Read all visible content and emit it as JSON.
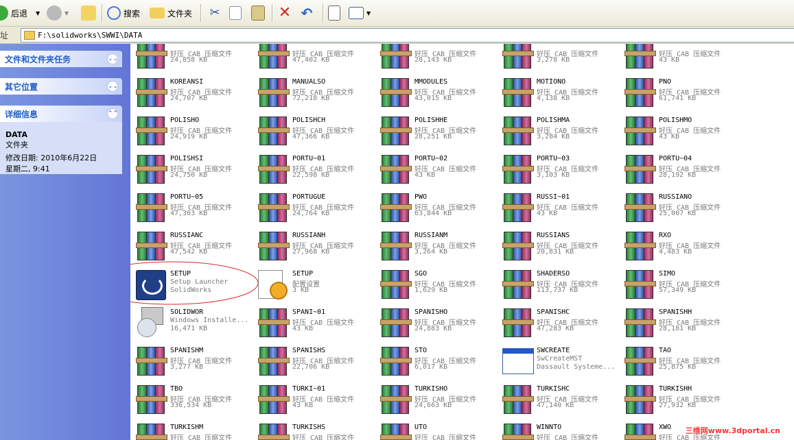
{
  "toolbar": {
    "back": "后退",
    "search": "搜索",
    "folders": "文件夹"
  },
  "address": {
    "label": "址",
    "path": "F:\\solidworks\\SWWI\\DATA"
  },
  "sidebar": {
    "panel1": "文件和文件夹任务",
    "panel2": "其它位置",
    "panel3": "详细信息",
    "detail_name": "DATA",
    "detail_type": "文件夹",
    "detail_modified": "修改日期: 2010年6月22日",
    "detail_time": "星期二, 9:41"
  },
  "files": [
    {
      "name": "",
      "type": "好压 CAB 压缩文件",
      "size": "24,858 KB",
      "icon": "winrar"
    },
    {
      "name": "",
      "type": "好压 CAB 压缩文件",
      "size": "47,402 KB",
      "icon": "winrar"
    },
    {
      "name": "",
      "type": "好压 CAB 压缩文件",
      "size": "28,143 KB",
      "icon": "winrar"
    },
    {
      "name": "",
      "type": "好压 CAB 压缩文件",
      "size": "3,278 KB",
      "icon": "winrar"
    },
    {
      "name": "",
      "type": "好压 CAB 压缩文件",
      "size": "43 KB",
      "icon": "winrar"
    },
    {
      "name": "KOREANSI",
      "type": "好压 CAB 压缩文件",
      "size": "24,707 KB",
      "icon": "winrar"
    },
    {
      "name": "MANUALSO",
      "type": "好压 CAB 压缩文件",
      "size": "72,218 KB",
      "icon": "winrar"
    },
    {
      "name": "MMODULES",
      "type": "好压 CAB 压缩文件",
      "size": "43,015 KB",
      "icon": "winrar"
    },
    {
      "name": "MOTIONO",
      "type": "好压 CAB 压缩文件",
      "size": "4,138 KB",
      "icon": "winrar"
    },
    {
      "name": "PNO",
      "type": "好压 CAB 压缩文件",
      "size": "61,741 KB",
      "icon": "winrar"
    },
    {
      "name": "POLISHO",
      "type": "好压 CAB 压缩文件",
      "size": "24,919 KB",
      "icon": "winrar"
    },
    {
      "name": "POLISHCH",
      "type": "好压 CAB 压缩文件",
      "size": "47,366 KB",
      "icon": "winrar"
    },
    {
      "name": "POLISHHE",
      "type": "好压 CAB 压缩文件",
      "size": "28,251 KB",
      "icon": "winrar"
    },
    {
      "name": "POLISHMA",
      "type": "好压 CAB 压缩文件",
      "size": "3,284 KB",
      "icon": "winrar"
    },
    {
      "name": "POLISHMO",
      "type": "好压 CAB 压缩文件",
      "size": "43 KB",
      "icon": "winrar"
    },
    {
      "name": "POLISHSI",
      "type": "好压 CAB 压缩文件",
      "size": "24,750 KB",
      "icon": "winrar"
    },
    {
      "name": "PORTU~01",
      "type": "好压 CAB 压缩文件",
      "size": "22,598 KB",
      "icon": "winrar"
    },
    {
      "name": "PORTU~02",
      "type": "好压 CAB 压缩文件",
      "size": "43 KB",
      "icon": "winrar"
    },
    {
      "name": "PORTU~03",
      "type": "好压 CAB 压缩文件",
      "size": "3,103 KB",
      "icon": "winrar"
    },
    {
      "name": "PORTU~04",
      "type": "好压 CAB 压缩文件",
      "size": "28,192 KB",
      "icon": "winrar"
    },
    {
      "name": "PORTU~05",
      "type": "好压 CAB 压缩文件",
      "size": "47,303 KB",
      "icon": "winrar"
    },
    {
      "name": "PORTUGUE",
      "type": "好压 CAB 压缩文件",
      "size": "24,764 KB",
      "icon": "winrar"
    },
    {
      "name": "PWO",
      "type": "好压 CAB 压缩文件",
      "size": "63,844 KB",
      "icon": "winrar"
    },
    {
      "name": "RUSSI~01",
      "type": "好压 CAB 压缩文件",
      "size": "43 KB",
      "icon": "winrar"
    },
    {
      "name": "RUSSIANO",
      "type": "好压 CAB 压缩文件",
      "size": "25,007 KB",
      "icon": "winrar"
    },
    {
      "name": "RUSSIANC",
      "type": "好压 CAB 压缩文件",
      "size": "47,542 KB",
      "icon": "winrar"
    },
    {
      "name": "RUSSIANH",
      "type": "好压 CAB 压缩文件",
      "size": "27,968 KB",
      "icon": "winrar"
    },
    {
      "name": "RUSSIANM",
      "type": "好压 CAB 压缩文件",
      "size": "3,264 KB",
      "icon": "winrar"
    },
    {
      "name": "RUSSIANS",
      "type": "好压 CAB 压缩文件",
      "size": "20,831 KB",
      "icon": "winrar"
    },
    {
      "name": "RXO",
      "type": "好压 CAB 压缩文件",
      "size": "4,483 KB",
      "icon": "winrar"
    },
    {
      "name": "SETUP",
      "type": "Setup Launcher",
      "size": "SolidWorks",
      "icon": "setup-exe"
    },
    {
      "name": "SETUP",
      "type": "配置设置",
      "size": "3 KB",
      "icon": "ini"
    },
    {
      "name": "SGO",
      "type": "好压 CAB 压缩文件",
      "size": "1,629 KB",
      "icon": "winrar"
    },
    {
      "name": "SHADERSO",
      "type": "好压 CAB 压缩文件",
      "size": "113,737 KB",
      "icon": "winrar"
    },
    {
      "name": "SIMO",
      "type": "好压 CAB 压缩文件",
      "size": "57,349 KB",
      "icon": "winrar"
    },
    {
      "name": "SOLIDWOR",
      "type": "Windows Installe...",
      "size": "16,471 KB",
      "icon": "msi"
    },
    {
      "name": "SPANI~01",
      "type": "好压 CAB 压缩文件",
      "size": "43 KB",
      "icon": "winrar"
    },
    {
      "name": "SPANISHO",
      "type": "好压 CAB 压缩文件",
      "size": "24,883 KB",
      "icon": "winrar"
    },
    {
      "name": "SPANISHC",
      "type": "好压 CAB 压缩文件",
      "size": "47,283 KB",
      "icon": "winrar"
    },
    {
      "name": "SPANISHH",
      "type": "好压 CAB 压缩文件",
      "size": "28,181 KB",
      "icon": "winrar"
    },
    {
      "name": "SPANISHM",
      "type": "好压 CAB 压缩文件",
      "size": "3,277 KB",
      "icon": "winrar"
    },
    {
      "name": "SPANISHS",
      "type": "好压 CAB 压缩文件",
      "size": "22,706 KB",
      "icon": "winrar"
    },
    {
      "name": "STO",
      "type": "好压 CAB 压缩文件",
      "size": "6,017 KB",
      "icon": "winrar"
    },
    {
      "name": "SWCREATE",
      "type": "SwCreateMST",
      "size": "Dassault Systeme...",
      "icon": "window"
    },
    {
      "name": "TAO",
      "type": "好压 CAB 压缩文件",
      "size": "25,875 KB",
      "icon": "winrar"
    },
    {
      "name": "TBO",
      "type": "好压 CAB 压缩文件",
      "size": "336,534 KB",
      "icon": "winrar"
    },
    {
      "name": "TURKI~01",
      "type": "好压 CAB 压缩文件",
      "size": "43 KB",
      "icon": "winrar"
    },
    {
      "name": "TURKISHO",
      "type": "好压 CAB 压缩文件",
      "size": "24,663 KB",
      "icon": "winrar"
    },
    {
      "name": "TURKISHC",
      "type": "好压 CAB 压缩文件",
      "size": "47,140 KB",
      "icon": "winrar"
    },
    {
      "name": "TURKISHH",
      "type": "好压 CAB 压缩文件",
      "size": "27,932 KB",
      "icon": "winrar"
    },
    {
      "name": "TURKISHM",
      "type": "好压 CAB 压缩文件",
      "size": "",
      "icon": "winrar"
    },
    {
      "name": "TURKISHS",
      "type": "好压 CAB 压缩文件",
      "size": "",
      "icon": "winrar"
    },
    {
      "name": "UTO",
      "type": "好压 CAB 压缩文件",
      "size": "",
      "icon": "winrar"
    },
    {
      "name": "WINNTO",
      "type": "好压 CAB 压缩文件",
      "size": "",
      "icon": "winrar"
    },
    {
      "name": "XWO",
      "type": "好压 CAB 压缩文件",
      "size": "",
      "icon": "winrar"
    }
  ],
  "watermark": "三维网www.3dportal.cn"
}
